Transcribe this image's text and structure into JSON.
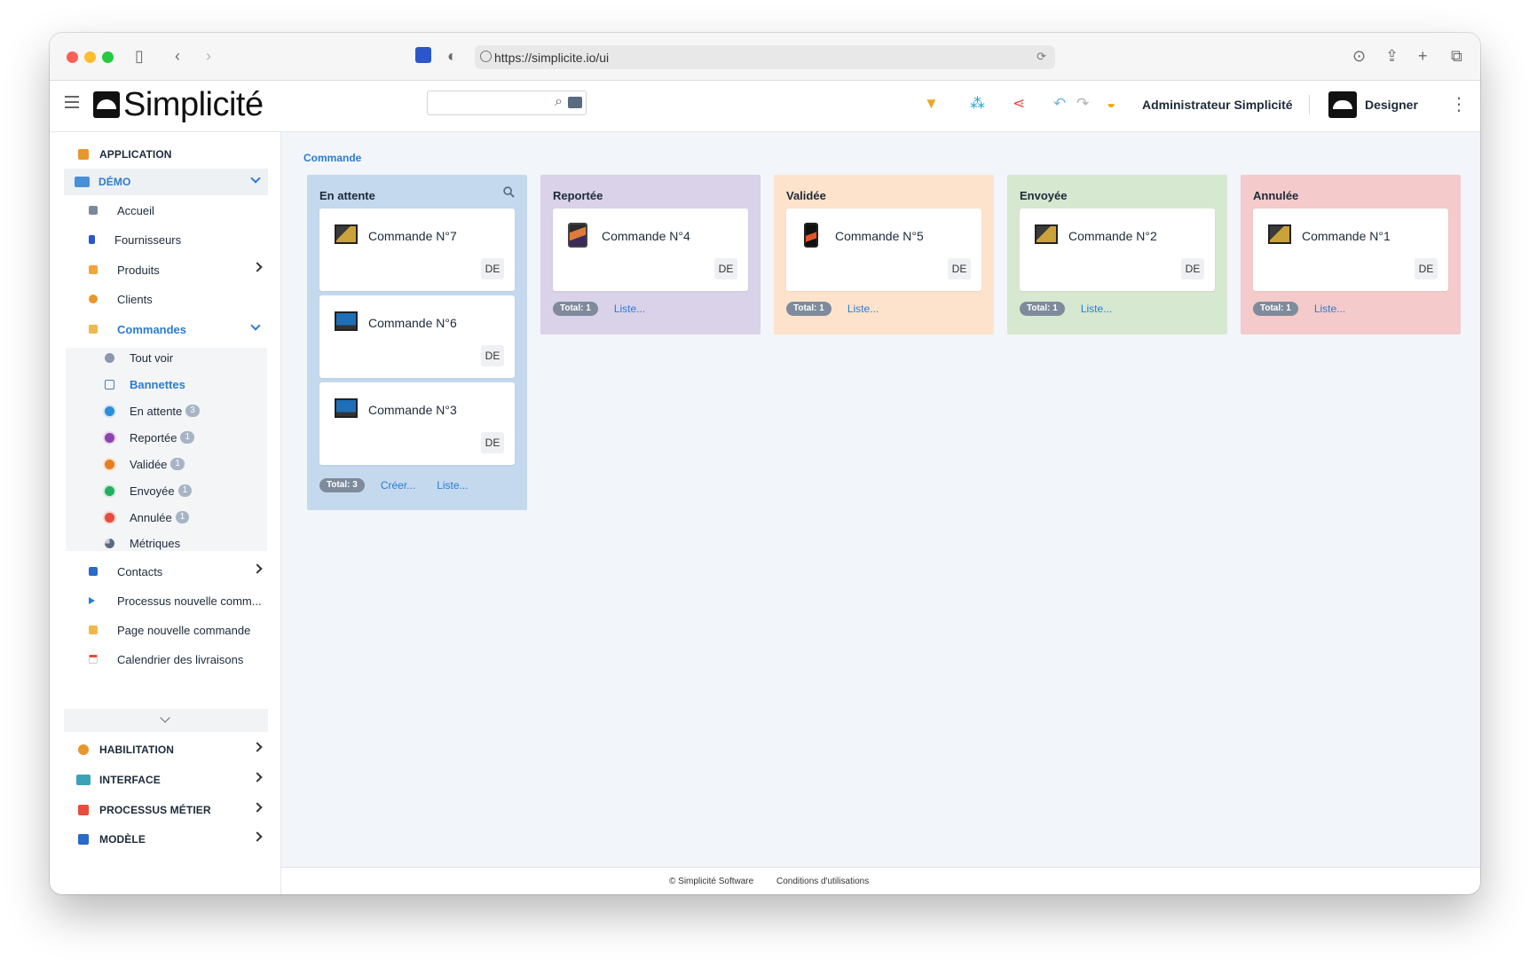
{
  "browser": {
    "url": "https://simplicite.io/ui"
  },
  "header": {
    "logo_text": "Simplicité",
    "search_placeholder": "",
    "user_name": "Administrateur Simplicité",
    "designer_label": "Designer"
  },
  "sidebar": {
    "sections": {
      "application": "APPLICATION",
      "demo": "DÉMO",
      "habilitation": "HABILITATION",
      "interface": "INTERFACE",
      "processus": "PROCESSUS MÉTIER",
      "modele": "MODÈLE"
    },
    "demo_items": {
      "accueil": "Accueil",
      "fournisseurs": "Fournisseurs",
      "produits": "Produits",
      "clients": "Clients",
      "commandes": "Commandes",
      "contacts": "Contacts",
      "processus": "Processus nouvelle comm...",
      "page": "Page nouvelle commande",
      "calendrier": "Calendrier des livraisons"
    },
    "commandes_items": {
      "tout_voir": "Tout voir",
      "bannettes": "Bannettes",
      "en_attente": "En attente",
      "en_attente_count": "3",
      "reportee": "Reportée",
      "reportee_count": "1",
      "validee": "Validée",
      "validee_count": "1",
      "envoyee": "Envoyée",
      "envoyee_count": "1",
      "annulee": "Annulée",
      "annulee_count": "1",
      "metriques": "Métriques"
    }
  },
  "main": {
    "breadcrumb": "Commande",
    "columns": [
      {
        "title": "En attente",
        "color": "#c5d9ee",
        "cards": [
          {
            "title": "Commande N°7",
            "tag": "DE"
          },
          {
            "title": "Commande N°6",
            "tag": "DE"
          },
          {
            "title": "Commande N°3",
            "tag": "DE"
          }
        ],
        "total": "Total: 3",
        "create": "Créer...",
        "list": "Liste..."
      },
      {
        "title": "Reportée",
        "color": "#d9d2e9",
        "cards": [
          {
            "title": "Commande N°4",
            "tag": "DE"
          }
        ],
        "total": "Total: 1",
        "list": "Liste..."
      },
      {
        "title": "Validée",
        "color": "#fde3cb",
        "cards": [
          {
            "title": "Commande N°5",
            "tag": "DE"
          }
        ],
        "total": "Total: 1",
        "list": "Liste..."
      },
      {
        "title": "Envoyée",
        "color": "#d6e8d0",
        "cards": [
          {
            "title": "Commande N°2",
            "tag": "DE"
          }
        ],
        "total": "Total: 1",
        "list": "Liste..."
      },
      {
        "title": "Annulée",
        "color": "#f4caca",
        "cards": [
          {
            "title": "Commande N°1",
            "tag": "DE"
          }
        ],
        "total": "Total: 1",
        "list": "Liste..."
      }
    ]
  },
  "footer": {
    "copyright": "© Simplicité Software",
    "terms": "Conditions d'utilisations"
  },
  "icons": {
    "status_dots": {
      "en_attente": "#2d8fd8",
      "reportee": "#8e44ad",
      "validee": "#e67e22",
      "envoyee": "#27ae60",
      "annulee": "#e74c3c"
    }
  }
}
